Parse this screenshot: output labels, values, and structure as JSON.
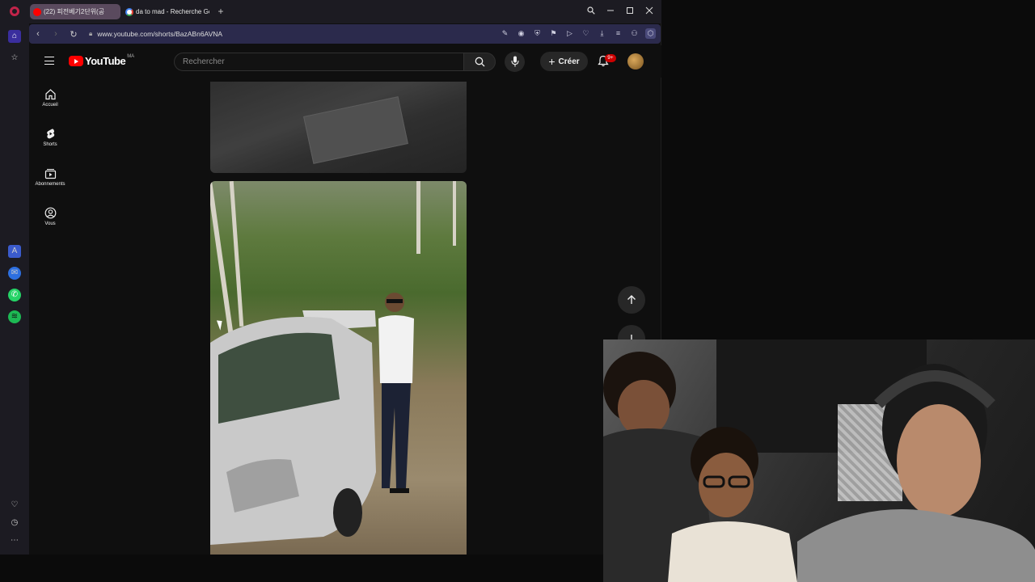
{
  "browser": {
    "tabs": [
      {
        "label": "(22) 피전베기2단위(공",
        "active": true
      },
      {
        "label": "da to mad - Recherche Go",
        "active": false
      }
    ],
    "new_tab_symbol": "+",
    "window_controls": [
      "search",
      "minimize",
      "maximize",
      "close"
    ],
    "url": "www.youtube.com/shorts/BazABn6AVNA"
  },
  "youtube": {
    "logo_text": "YouTube",
    "region": "MA",
    "search_placeholder": "Rechercher",
    "create_label": "Créer",
    "notification_badge": "9+",
    "guide": [
      {
        "label": "Accueil",
        "icon": "home-icon"
      },
      {
        "label": "Shorts",
        "icon": "shorts-icon"
      },
      {
        "label": "Abonnements",
        "icon": "subscriptions-icon"
      },
      {
        "label": "Vous",
        "icon": "you-icon"
      }
    ]
  },
  "colors": {
    "youtube_red": "#ff0000",
    "background": "#0f0f0f",
    "opera_sidebar": "#1c1b22",
    "address_bar": "#2b2a4c"
  }
}
